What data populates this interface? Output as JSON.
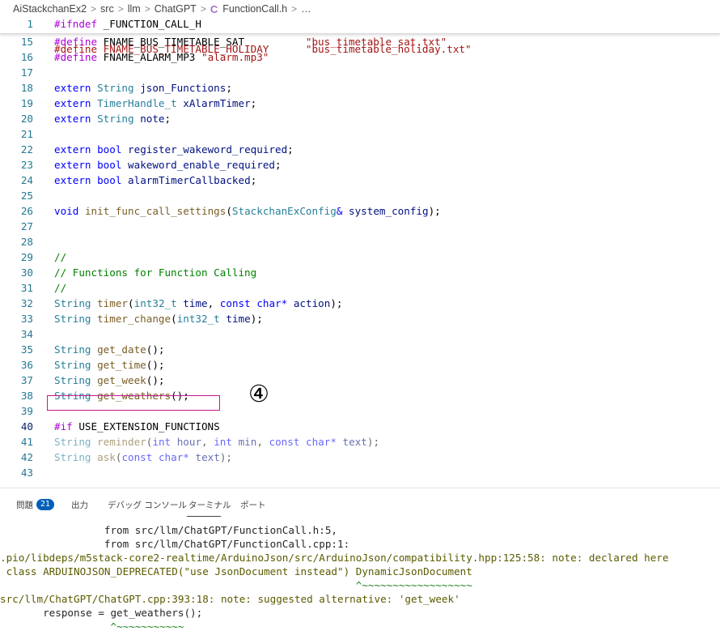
{
  "breadcrumb": {
    "items": [
      "AiStackchanEx2",
      "src",
      "llm",
      "ChatGPT",
      "FunctionCall.h",
      "…"
    ],
    "separator": ">",
    "file_icon": "C"
  },
  "editor": {
    "sticky": {
      "num": "1",
      "text": "#ifndef _FUNCTION_CALL_H"
    },
    "partial_line": {
      "text": "#define FNAME_BUS_TIMETABLE_HOLIDAY      \"bus_timetable_holiday.txt\""
    },
    "lines": [
      {
        "num": "15",
        "segs": [
          [
            "pp",
            "#define"
          ],
          [
            "plain",
            " FNAME_BUS_TIMETABLE_SAT          "
          ],
          [
            "st",
            "\"bus_timetable_sat.txt\""
          ]
        ]
      },
      {
        "num": "16",
        "segs": [
          [
            "pp",
            "#define"
          ],
          [
            "plain",
            " FNAME_ALARM_MP3 "
          ],
          [
            "st",
            "\"alarm.mp3\""
          ]
        ]
      },
      {
        "num": "17",
        "segs": []
      },
      {
        "num": "18",
        "segs": [
          [
            "kw",
            "extern"
          ],
          [
            "plain",
            " "
          ],
          [
            "ty",
            "String"
          ],
          [
            "plain",
            " "
          ],
          [
            "vr",
            "json_Functions"
          ],
          [
            "plain",
            ";"
          ]
        ]
      },
      {
        "num": "19",
        "segs": [
          [
            "kw",
            "extern"
          ],
          [
            "plain",
            " "
          ],
          [
            "ty",
            "TimerHandle_t"
          ],
          [
            "plain",
            " "
          ],
          [
            "vr",
            "xAlarmTimer"
          ],
          [
            "plain",
            ";"
          ]
        ]
      },
      {
        "num": "20",
        "segs": [
          [
            "kw",
            "extern"
          ],
          [
            "plain",
            " "
          ],
          [
            "ty",
            "String"
          ],
          [
            "plain",
            " "
          ],
          [
            "vr",
            "note"
          ],
          [
            "plain",
            ";"
          ]
        ]
      },
      {
        "num": "21",
        "segs": []
      },
      {
        "num": "22",
        "segs": [
          [
            "kw",
            "extern"
          ],
          [
            "plain",
            " "
          ],
          [
            "kw",
            "bool"
          ],
          [
            "plain",
            " "
          ],
          [
            "vr",
            "register_wakeword_required"
          ],
          [
            "plain",
            ";"
          ]
        ]
      },
      {
        "num": "23",
        "segs": [
          [
            "kw",
            "extern"
          ],
          [
            "plain",
            " "
          ],
          [
            "kw",
            "bool"
          ],
          [
            "plain",
            " "
          ],
          [
            "vr",
            "wakeword_enable_required"
          ],
          [
            "plain",
            ";"
          ]
        ]
      },
      {
        "num": "24",
        "segs": [
          [
            "kw",
            "extern"
          ],
          [
            "plain",
            " "
          ],
          [
            "kw",
            "bool"
          ],
          [
            "plain",
            " "
          ],
          [
            "vr",
            "alarmTimerCallbacked"
          ],
          [
            "plain",
            ";"
          ]
        ]
      },
      {
        "num": "25",
        "segs": []
      },
      {
        "num": "26",
        "segs": [
          [
            "kw",
            "void"
          ],
          [
            "plain",
            " "
          ],
          [
            "fn",
            "init_func_call_settings"
          ],
          [
            "plain",
            "("
          ],
          [
            "ty",
            "StackchanExConfig"
          ],
          [
            "kw",
            "&"
          ],
          [
            "plain",
            " "
          ],
          [
            "vr",
            "system_config"
          ],
          [
            "plain",
            ");"
          ]
        ]
      },
      {
        "num": "27",
        "segs": []
      },
      {
        "num": "28",
        "segs": []
      },
      {
        "num": "29",
        "segs": [
          [
            "cm",
            "//"
          ]
        ]
      },
      {
        "num": "30",
        "segs": [
          [
            "cm",
            "// Functions for Function Calling"
          ]
        ]
      },
      {
        "num": "31",
        "segs": [
          [
            "cm",
            "//"
          ]
        ]
      },
      {
        "num": "32",
        "segs": [
          [
            "ty",
            "String"
          ],
          [
            "plain",
            " "
          ],
          [
            "fn",
            "timer"
          ],
          [
            "plain",
            "("
          ],
          [
            "ty",
            "int32_t"
          ],
          [
            "plain",
            " "
          ],
          [
            "vr",
            "time"
          ],
          [
            "plain",
            ", "
          ],
          [
            "kw",
            "const"
          ],
          [
            "plain",
            " "
          ],
          [
            "kw",
            "char"
          ],
          [
            "kw",
            "*"
          ],
          [
            "plain",
            " "
          ],
          [
            "vr",
            "action"
          ],
          [
            "plain",
            ");"
          ]
        ]
      },
      {
        "num": "33",
        "segs": [
          [
            "ty",
            "String"
          ],
          [
            "plain",
            " "
          ],
          [
            "fn",
            "timer_change"
          ],
          [
            "plain",
            "("
          ],
          [
            "ty",
            "int32_t"
          ],
          [
            "plain",
            " "
          ],
          [
            "vr",
            "time"
          ],
          [
            "plain",
            ");"
          ]
        ]
      },
      {
        "num": "34",
        "segs": []
      },
      {
        "num": "35",
        "segs": [
          [
            "ty",
            "String"
          ],
          [
            "plain",
            " "
          ],
          [
            "fn",
            "get_date"
          ],
          [
            "plain",
            "();"
          ]
        ]
      },
      {
        "num": "36",
        "segs": [
          [
            "ty",
            "String"
          ],
          [
            "plain",
            " "
          ],
          [
            "fn",
            "get_time"
          ],
          [
            "plain",
            "();"
          ]
        ]
      },
      {
        "num": "37",
        "segs": [
          [
            "ty",
            "String"
          ],
          [
            "plain",
            " "
          ],
          [
            "fn",
            "get_week"
          ],
          [
            "plain",
            "();"
          ]
        ]
      },
      {
        "num": "38",
        "segs": [
          [
            "ty",
            "String"
          ],
          [
            "plain",
            " "
          ],
          [
            "fn",
            "get_weathers"
          ],
          [
            "plain",
            "();"
          ]
        ]
      },
      {
        "num": "39",
        "segs": []
      },
      {
        "num": "40",
        "segs": [
          [
            "pp",
            "#if"
          ],
          [
            "plain",
            " USE_EXTENSION_FUNCTIONS"
          ]
        ],
        "active": true
      },
      {
        "num": "41",
        "segs": [
          [
            "ty",
            "String"
          ],
          [
            "plain",
            " "
          ],
          [
            "fn",
            "reminder"
          ],
          [
            "plain",
            "("
          ],
          [
            "kw",
            "int"
          ],
          [
            "plain",
            " "
          ],
          [
            "vr",
            "hour"
          ],
          [
            "plain",
            ", "
          ],
          [
            "kw",
            "int"
          ],
          [
            "plain",
            " "
          ],
          [
            "vr",
            "min"
          ],
          [
            "plain",
            ", "
          ],
          [
            "kw",
            "const"
          ],
          [
            "plain",
            " "
          ],
          [
            "kw",
            "char"
          ],
          [
            "kw",
            "*"
          ],
          [
            "plain",
            " "
          ],
          [
            "vr",
            "text"
          ],
          [
            "plain",
            ");"
          ]
        ],
        "dim": true
      },
      {
        "num": "42",
        "segs": [
          [
            "ty",
            "String"
          ],
          [
            "plain",
            " "
          ],
          [
            "fn",
            "ask"
          ],
          [
            "plain",
            "("
          ],
          [
            "kw",
            "const"
          ],
          [
            "plain",
            " "
          ],
          [
            "kw",
            "char"
          ],
          [
            "kw",
            "*"
          ],
          [
            "plain",
            " "
          ],
          [
            "vr",
            "text"
          ],
          [
            "plain",
            ");"
          ]
        ],
        "dim": true
      },
      {
        "num": "43",
        "segs": []
      }
    ]
  },
  "annotation": {
    "label": "④"
  },
  "panel": {
    "tabs": [
      {
        "label": "問題",
        "badge": "21"
      },
      {
        "label": "出力"
      },
      {
        "label": "デバッグ コンソール"
      },
      {
        "label": "ターミナル",
        "active": true
      },
      {
        "label": "ポート"
      }
    ]
  },
  "terminal": {
    "lines": [
      {
        "text": "                 from src/llm/ChatGPT/FunctionCall.h:5,",
        "cls": "tdark"
      },
      {
        "text": "                 from src/llm/ChatGPT/FunctionCall.cpp:1:",
        "cls": "tdark"
      },
      {
        "text": ".pio/libdeps/m5stack-core2-realtime/ArduinoJson/src/ArduinoJson/compatibility.hpp:125:58: note: declared here",
        "cls": "tnote"
      },
      {
        "text": " class ARDUINOJSON_DEPRECATED(\"use JsonDocument instead\") DynamicJsonDocument",
        "cls": "tnote"
      },
      {
        "text": "                                                          ^~~~~~~~~~~~~~~~~~~",
        "cls": "tgreen"
      },
      {
        "text": "src/llm/ChatGPT/ChatGPT.cpp:393:18: note: suggested alternative: 'get_week'",
        "cls": "tnote"
      },
      {
        "text": "       response = get_weathers();",
        "cls": "tdark"
      },
      {
        "text": "                  ^~~~~~~~~~~~",
        "cls": "tgreen"
      }
    ]
  }
}
